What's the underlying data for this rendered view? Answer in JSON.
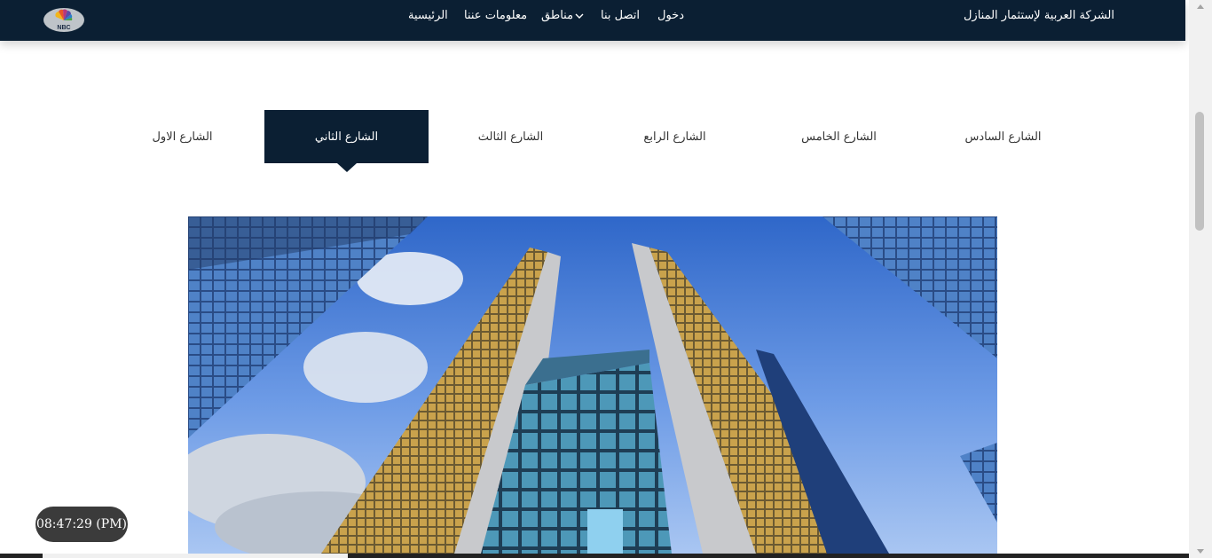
{
  "header": {
    "brand": "الشركة العربية لإستثمار المنازل",
    "logo_text": "NBC",
    "nav": [
      {
        "label": "الرئيسية"
      },
      {
        "label": "معلومات عننا"
      },
      {
        "label": "مناطق"
      },
      {
        "label": "اتصل بنا"
      },
      {
        "label": "دخول"
      }
    ]
  },
  "tabs": [
    {
      "label": "الشارع الاول",
      "active": false
    },
    {
      "label": "الشارع الثاني",
      "active": true
    },
    {
      "label": "الشارع الثالث",
      "active": false
    },
    {
      "label": "الشارع الرابع",
      "active": false
    },
    {
      "label": "الشارع الخامس",
      "active": false
    },
    {
      "label": "الشارع السادس",
      "active": false
    }
  ],
  "hero": {
    "image": "city-skyscrapers-photo"
  },
  "clock": {
    "time": "08:47:29 (PM)"
  },
  "colors": {
    "navy": "#0b1f33",
    "sky": "#3f7fd6",
    "clock_bg": "#3b3b3b"
  }
}
